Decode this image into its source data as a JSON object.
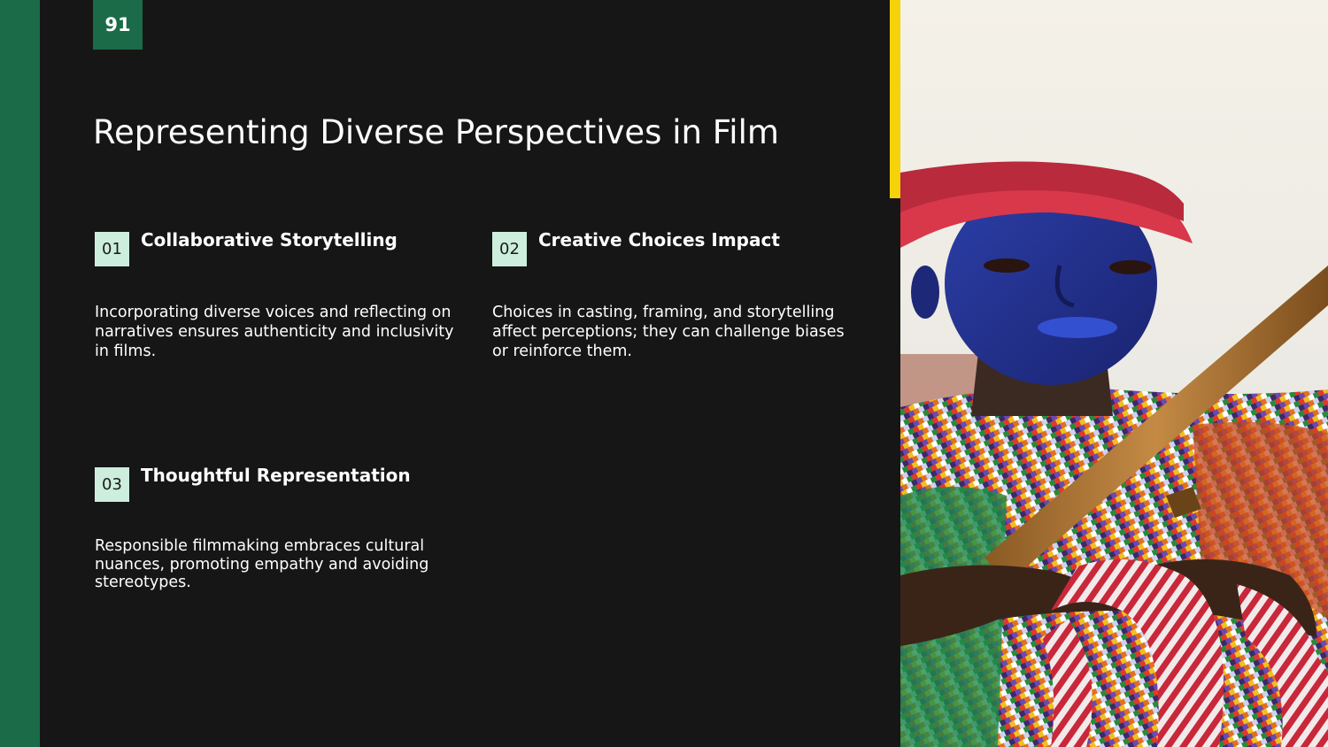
{
  "slide": {
    "page_number": "91",
    "title": "Representing Diverse Perspectives in Film",
    "items": [
      {
        "number": "01",
        "title": "Collaborative Storytelling",
        "description": "Incorporating diverse voices and reflecting on narratives ensures authenticity and inclusivity in films."
      },
      {
        "number": "02",
        "title": "Creative Choices Impact",
        "description": "Choices in casting, framing, and storytelling affect perceptions; they can challenge biases or reinforce them."
      },
      {
        "number": "03",
        "title": "Thoughtful Representation",
        "description": "Responsible filmmaking embraces cultural nuances, promoting empathy and avoiding stereotypes."
      }
    ]
  },
  "colors": {
    "background": "#161616",
    "green": "#1b6b48",
    "mint": "#cdeedd",
    "yellow": "#f5d20a"
  }
}
